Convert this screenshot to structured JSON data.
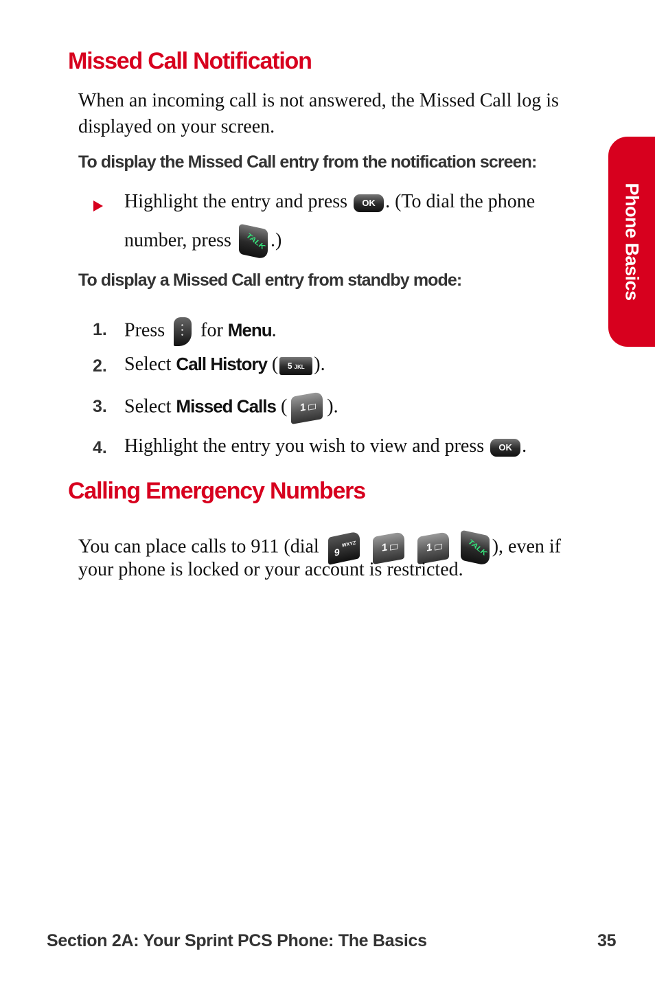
{
  "section1": {
    "title": "Missed Call Notification",
    "intro": "When an incoming call is not answered, the Missed Call log is displayed on your screen.",
    "subhead1": "To display the Missed Call entry from the notification screen:",
    "bullet": {
      "part1": "Highlight the entry and press",
      "part2": ". (To dial the phone",
      "part3": "number, press",
      "part4": ".)"
    },
    "subhead2": "To display a Missed Call entry from standby mode:",
    "steps": [
      {
        "num": "1.",
        "pre": "Press",
        "mid": "for",
        "bold": "Menu",
        "post": "."
      },
      {
        "num": "2.",
        "pre": "Select",
        "bold": "Call History",
        "open": " (",
        "post": ")."
      },
      {
        "num": "3.",
        "pre": "Select",
        "bold": "Missed Calls",
        "open": " (",
        "post": ")."
      },
      {
        "num": "4.",
        "pre": "Highlight the entry you wish to view and press",
        "post": "."
      }
    ]
  },
  "section2": {
    "title": "Calling Emergency Numbers",
    "text_pre": "You can place calls to 911 (dial",
    "text_post": "), even if",
    "text_line2": "your phone is locked or your account is restricted."
  },
  "keys": {
    "ok": "OK",
    "talk": "TALK",
    "five": "5",
    "five_letters": "JKL",
    "one": "1",
    "nine": "9",
    "nine_letters": "WXYZ"
  },
  "side_tab": "Phone Basics",
  "footer": {
    "section": "Section 2A: Your Sprint PCS Phone: The Basics",
    "page": "35"
  },
  "colors": {
    "accent": "#d7001e"
  }
}
